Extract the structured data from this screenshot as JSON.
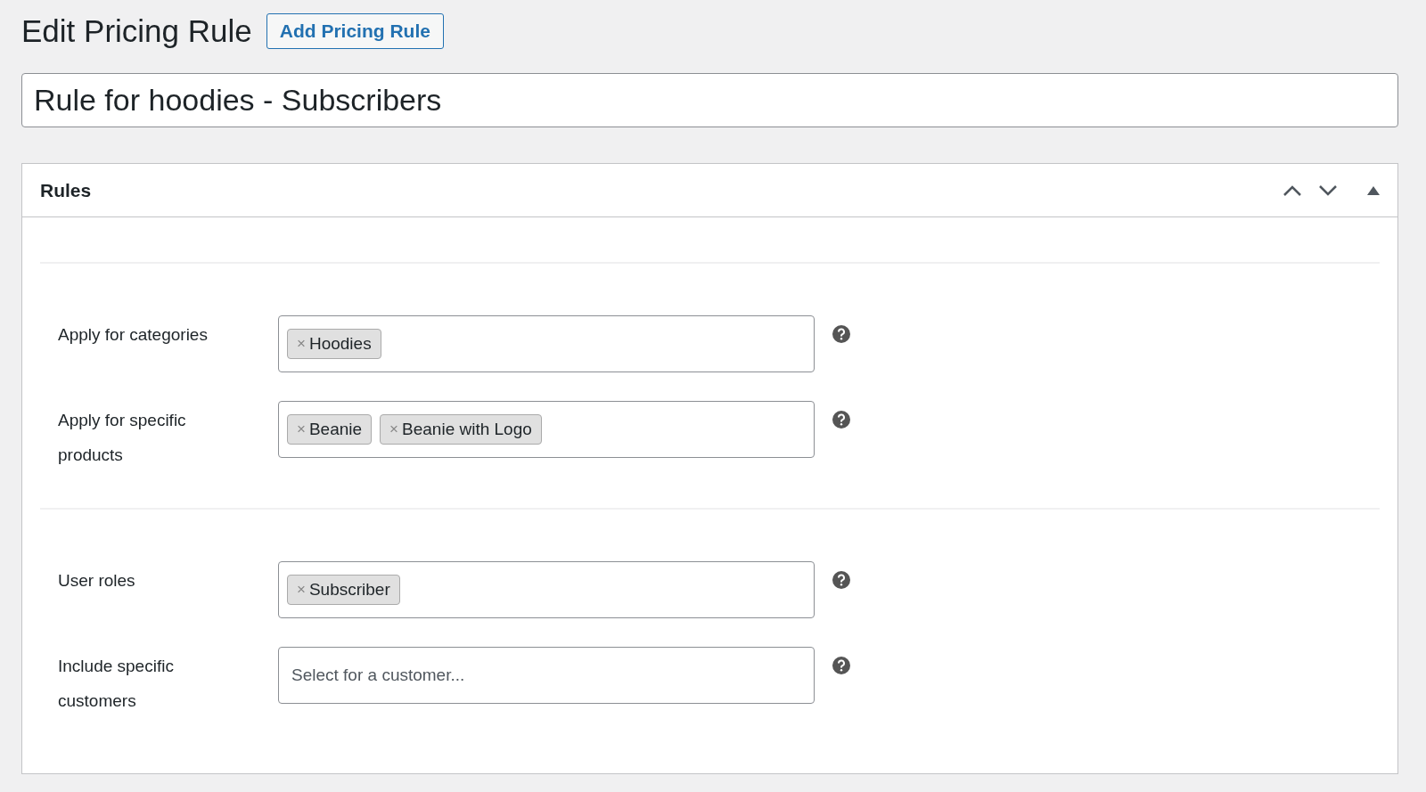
{
  "page_title": "Edit Pricing Rule",
  "add_button": "Add Pricing Rule",
  "rule_name": "Rule for hoodies - Subscribers",
  "panel": {
    "title": "Rules",
    "sections": [
      {
        "fields": [
          {
            "label": "Apply for categories",
            "tags": [
              {
                "remove": "×",
                "label": "Hoodies"
              }
            ]
          },
          {
            "label": "Apply for specific products",
            "tags": [
              {
                "remove": "×",
                "label": "Beanie"
              },
              {
                "remove": "×",
                "label": "Beanie with Logo"
              }
            ]
          }
        ]
      },
      {
        "fields": [
          {
            "label": "User roles",
            "tags": [
              {
                "remove": "×",
                "label": "Subscriber"
              }
            ]
          },
          {
            "label": "Include specific customers",
            "placeholder": "Select for a customer..."
          }
        ]
      }
    ]
  }
}
